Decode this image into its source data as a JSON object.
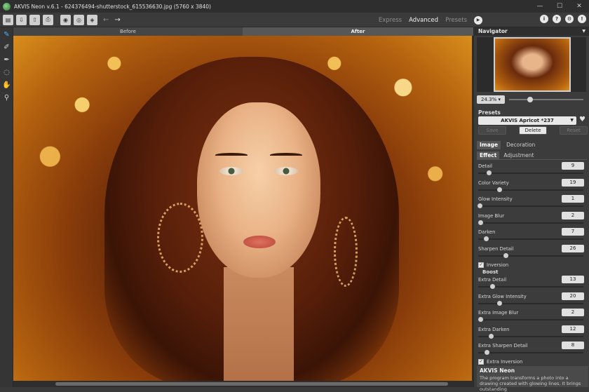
{
  "app": {
    "title": "AKVIS Neon v.6.1 - 624376494-shutterstock_615536630.jpg (5760 x 3840)"
  },
  "window_controls": {
    "minimize": "—",
    "maximize": "☐",
    "close": "✕"
  },
  "toolbar": {
    "buttons": [
      "open-icon",
      "save-icon",
      "export-icon",
      "print-icon",
      "batch-icon",
      "preferences-icon",
      "plugin-icon"
    ],
    "modes": [
      "Express",
      "Advanced",
      "Presets"
    ],
    "active_mode": "Advanced"
  },
  "tools": [
    "neon-brush-icon",
    "eraser-icon",
    "dropper-icon",
    "lasso-icon",
    "hand-icon",
    "zoom-icon"
  ],
  "canvas": {
    "before_label": "Before",
    "after_label": "After"
  },
  "navigator": {
    "title": "Navigator",
    "zoom": "24.3%"
  },
  "presets": {
    "label": "Presets",
    "selected": "AKVIS Apricot *237",
    "save": "Save",
    "delete": "Delete",
    "reset": "Reset"
  },
  "tabs": {
    "image": "Image",
    "decoration": "Decoration",
    "effect": "Effect",
    "adjustment": "Adjustment"
  },
  "params": [
    {
      "label": "Detail",
      "value": "9",
      "pos": 0.1
    },
    {
      "label": "Color Variety",
      "value": "19",
      "pos": 0.2
    },
    {
      "label": "Glow Intensity",
      "value": "1",
      "pos": 0.01
    },
    {
      "label": "Image Blur",
      "value": "2",
      "pos": 0.02
    },
    {
      "label": "Darken",
      "value": "7",
      "pos": 0.07
    },
    {
      "label": "Sharpen Detail",
      "value": "26",
      "pos": 0.26
    }
  ],
  "inversion_label": "Inversion",
  "boost_label": "Boost",
  "boost_params": [
    {
      "label": "Extra Detail",
      "value": "13",
      "pos": 0.13
    },
    {
      "label": "Extra Glow Intensity",
      "value": "20",
      "pos": 0.2
    },
    {
      "label": "Extra Image Blur",
      "value": "2",
      "pos": 0.02
    },
    {
      "label": "Extra Darken",
      "value": "12",
      "pos": 0.12
    },
    {
      "label": "Extra Sharpen Detail",
      "value": "8",
      "pos": 0.08
    }
  ],
  "extra_inversion_label": "Extra Inversion",
  "info": {
    "title": "AKVIS Neon",
    "text": "The program transforms a photo into a drawing created with glowing lines. It brings outstanding"
  }
}
